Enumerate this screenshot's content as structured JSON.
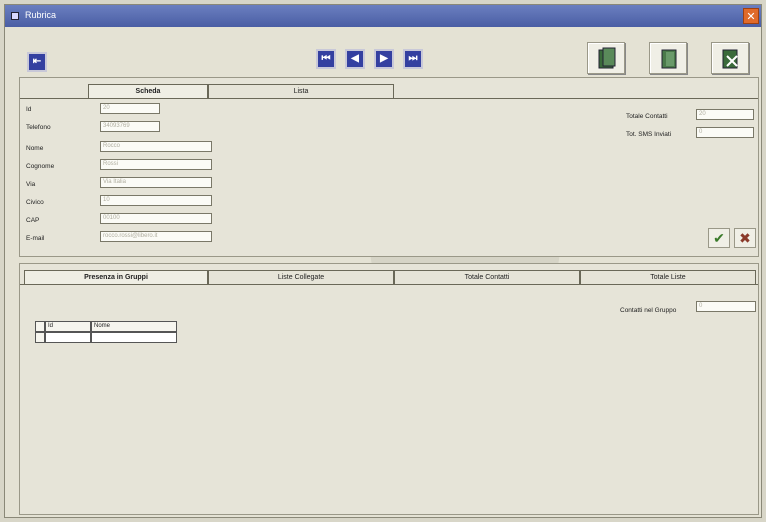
{
  "window": {
    "title": "Rubrica"
  },
  "scheda": {
    "tabs": [
      "Scheda",
      "Lista"
    ],
    "fields": [
      {
        "label": "Id",
        "value": "20"
      },
      {
        "label": "Telefono",
        "value": "34093769"
      },
      {
        "label": "Nome",
        "value": "Rocco"
      },
      {
        "label": "Cognome",
        "value": "Rossi"
      },
      {
        "label": "Via",
        "value": "Via Italia"
      },
      {
        "label": "Civico",
        "value": "10"
      },
      {
        "label": "CAP",
        "value": "00100"
      },
      {
        "label": "E-mail",
        "value": "rocco.rossi@libero.it"
      }
    ],
    "totale_contatti": {
      "label": "Totale Contatti",
      "value": "20"
    },
    "tot_sms": {
      "label": "Tot. SMS Inviati",
      "value": "0"
    }
  },
  "bottom": {
    "tabs": [
      "Presenza in Gruppi",
      "Liste Collegate",
      "Totale Contatti",
      "Totale Liste"
    ],
    "contatti_gruppo": {
      "label": "Contatti nel Gruppo",
      "value": "0"
    },
    "grid_headers": [
      "Id",
      "Nome"
    ]
  },
  "icons": {
    "first": "first-record-icon",
    "prev": "previous-record-icon",
    "next": "next-record-icon",
    "last": "last-record-icon",
    "confirm": "checkmark-icon",
    "cancel": "cancel-icon"
  }
}
